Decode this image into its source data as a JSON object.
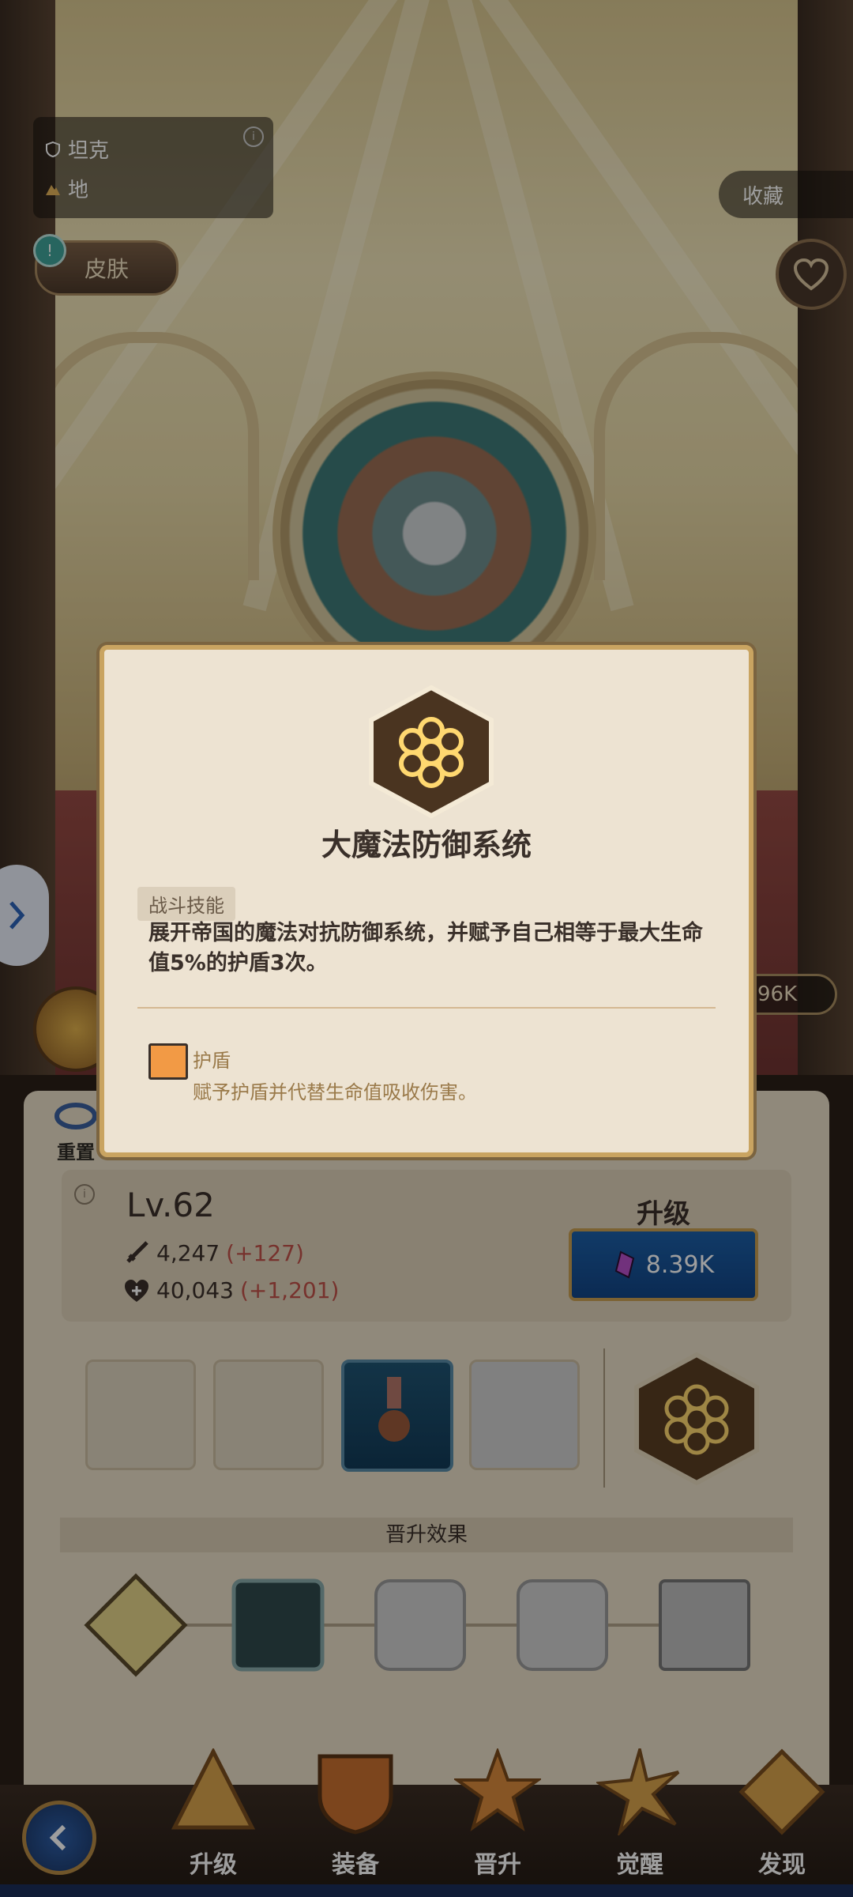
{
  "hero": {
    "role": "坦克",
    "terrain": "地"
  },
  "top": {
    "skin_label": "皮肤",
    "favorite_label": "收藏",
    "power_value": "96K"
  },
  "panel": {
    "reset_label": "重置",
    "level": "Lv.62",
    "attack": "4,247",
    "attack_bonus": "(+127)",
    "hp": "40,043",
    "hp_bonus": "(+1,201)",
    "upgrade_label": "升级",
    "upgrade_cost": "8.39K",
    "promotion_title": "晋升效果"
  },
  "popup": {
    "skill_name": "大魔法防御系统",
    "skill_type": "战斗技能",
    "description": "展开帝国的魔法对抗防御系统，并赋予自己相等于最大生命值5%的护盾3次。",
    "status_name": "护盾",
    "status_desc": "赋予护盾并代替生命值吸收伤害。"
  },
  "nav": {
    "items": [
      {
        "label": "升级"
      },
      {
        "label": "装备"
      },
      {
        "label": "晋升"
      },
      {
        "label": "觉醒"
      },
      {
        "label": "发现"
      }
    ]
  },
  "colors": {
    "accent_blue": "#1c5fa7",
    "gold": "#c9a461",
    "bonus_red": "#c0514a"
  },
  "icons": [
    "shield-icon",
    "mountain-icon",
    "info-icon",
    "heart-icon",
    "chevron-right-icon",
    "sword-icon",
    "heart-plus-icon",
    "gem-icon",
    "hexagon-skill-icon",
    "back-arrow-icon"
  ]
}
